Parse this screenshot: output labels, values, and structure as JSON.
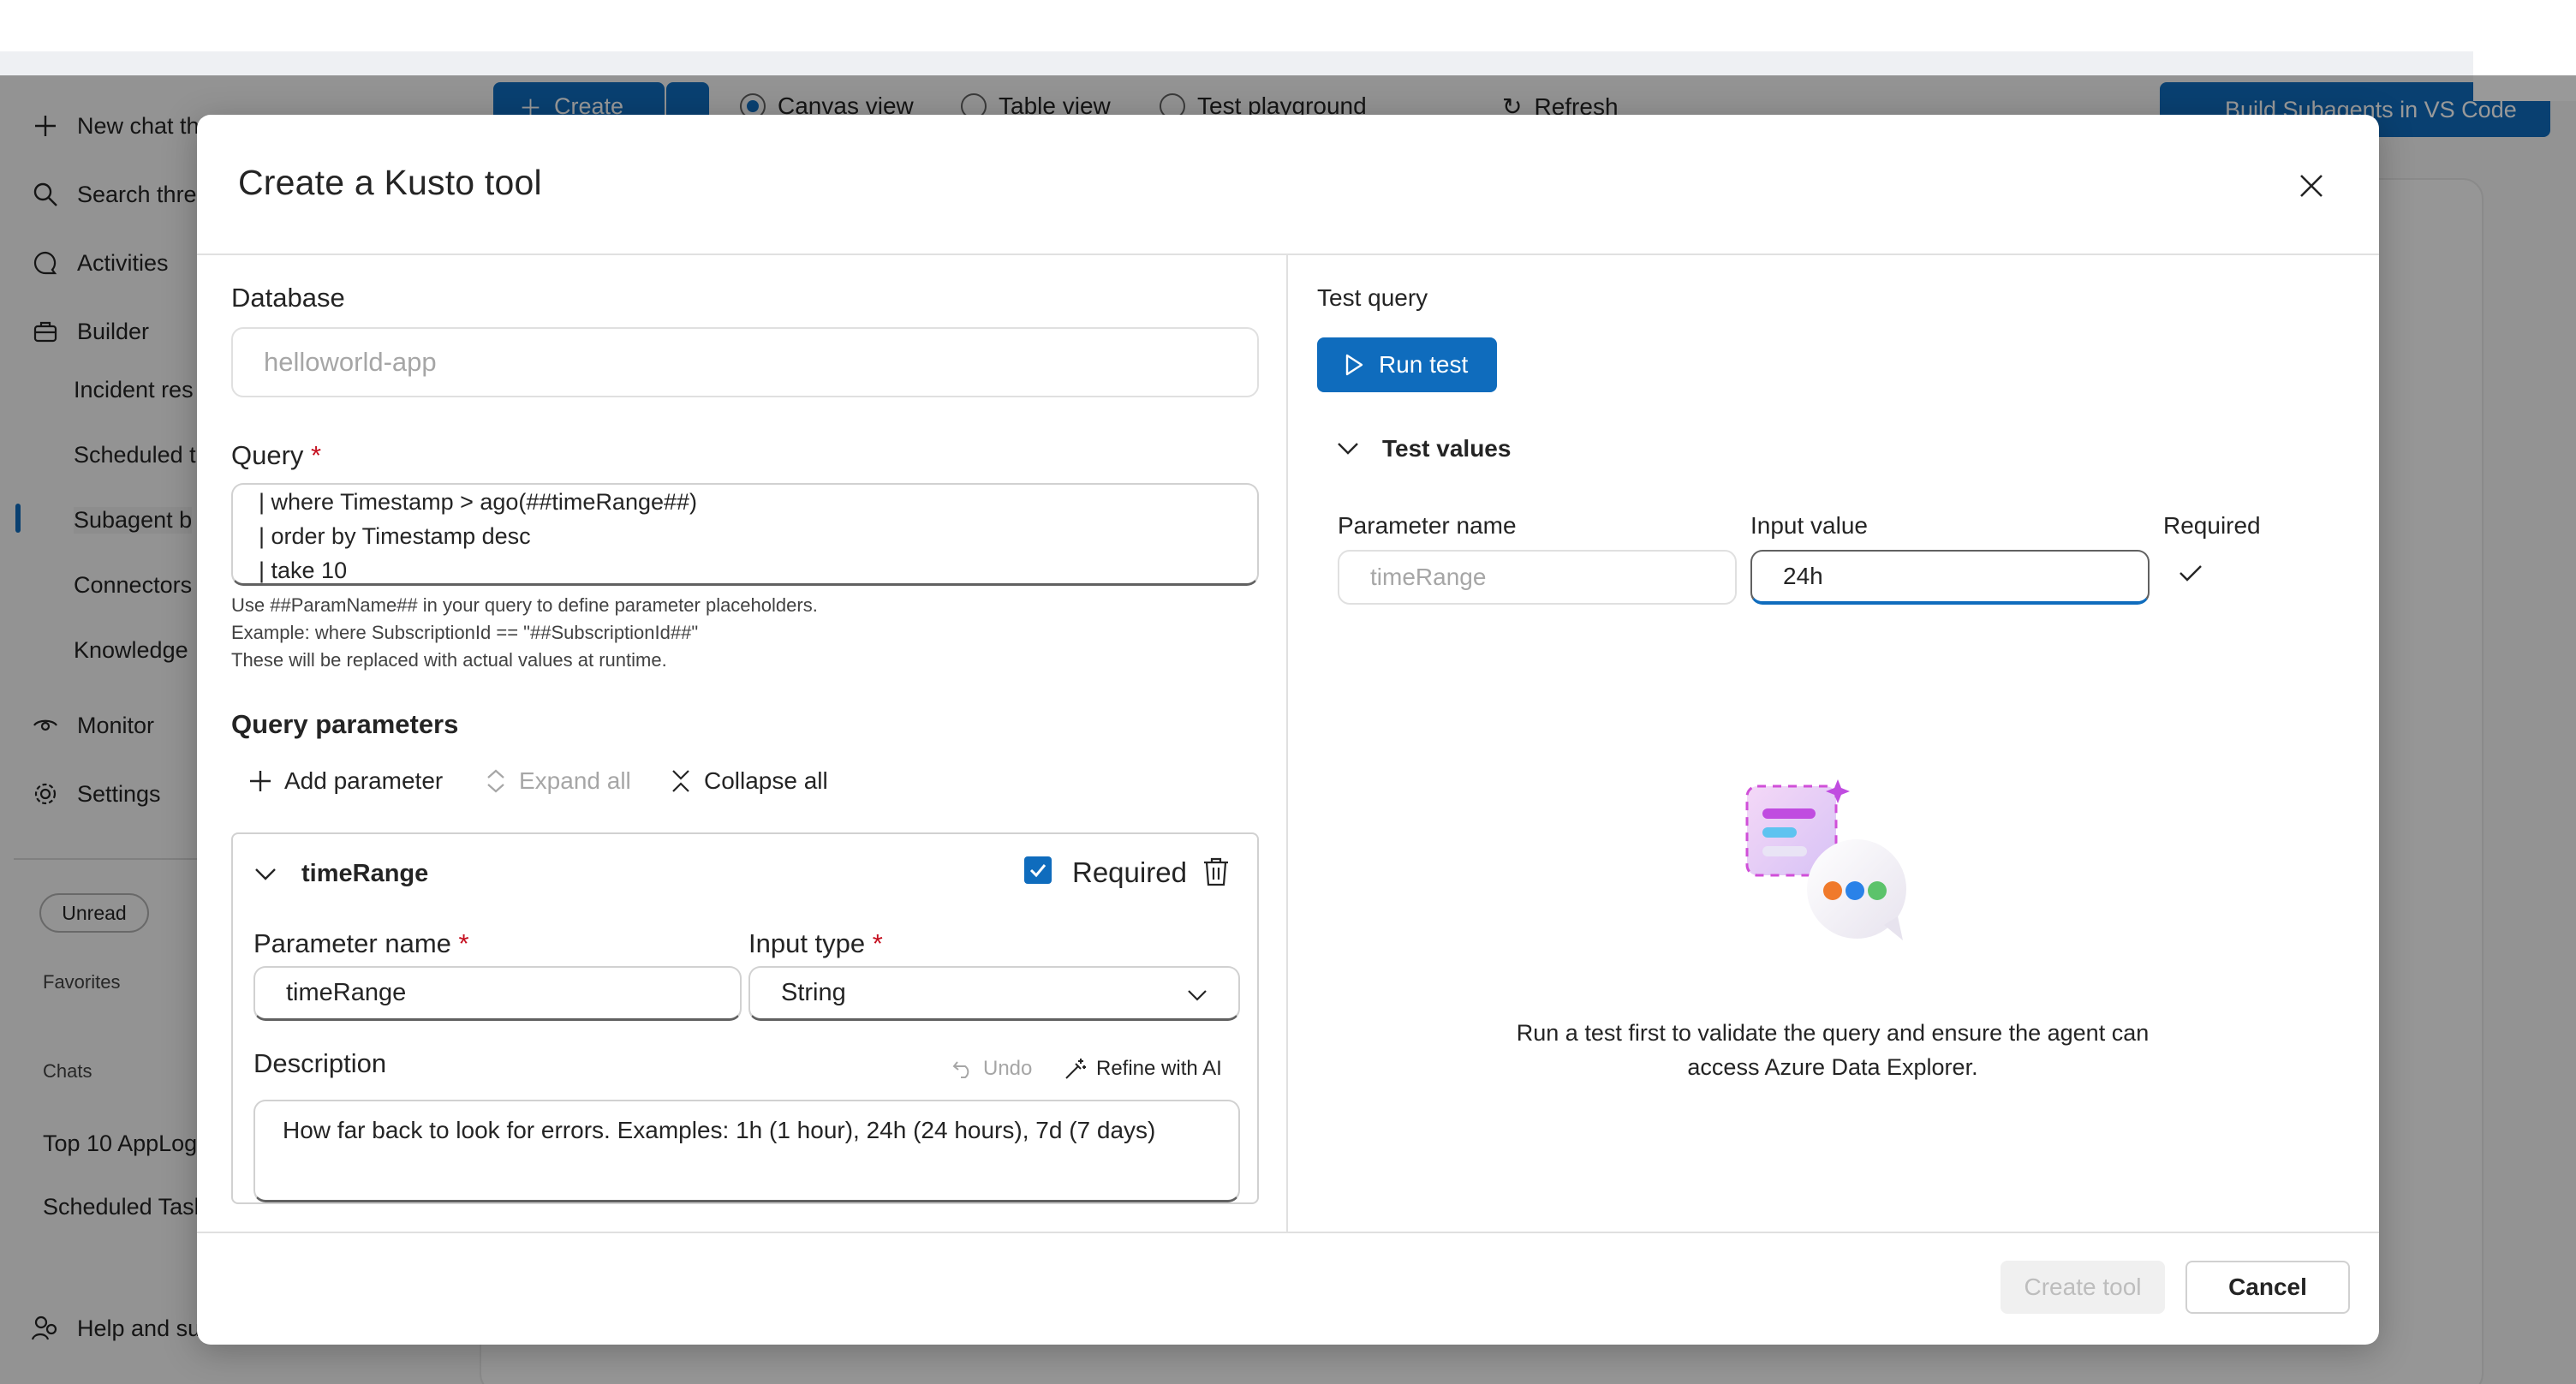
{
  "background_app": {
    "sidebar": {
      "nav": [
        {
          "label": "New chat th",
          "icon": "plus-icon"
        },
        {
          "label": "Search thre",
          "icon": "search-icon"
        },
        {
          "label": "Activities",
          "icon": "chat-bubble-icon"
        },
        {
          "label": "Builder",
          "icon": "briefcase-icon"
        }
      ],
      "builder_items": [
        "Incident res",
        "Scheduled t",
        "Subagent b",
        "Connectors",
        "Knowledge"
      ],
      "monitor": "Monitor",
      "settings": "Settings",
      "unread_chip": "Unread",
      "favorites_heading": "Favorites",
      "chats_heading": "Chats",
      "chat_items": [
        "Top 10 AppLog",
        "Scheduled Tasl"
      ],
      "help": "Help and su"
    },
    "toolbar": {
      "create_label": "Create",
      "views": [
        {
          "label": "Canvas view",
          "selected": true
        },
        {
          "label": "Table view",
          "selected": false
        },
        {
          "label": "Test playground",
          "selected": false
        }
      ],
      "refresh_label": "Refresh",
      "vscode_label": "Build Subagents in VS Code"
    }
  },
  "dialog": {
    "title": "Create a Kusto tool",
    "left": {
      "database_label": "Database",
      "database_placeholder": "helloworld-app",
      "query_label": "Query",
      "query_lines": [
        "| where Timestamp > ago(##timeRange##)",
        "| order by Timestamp desc",
        "| take 10"
      ],
      "hints": [
        "Use ##ParamName## in your query to define parameter placeholders.",
        "Example: where SubscriptionId == \"##SubscriptionId##\"",
        "These will be replaced with actual values at runtime."
      ],
      "params_heading": "Query parameters",
      "add_param": "Add parameter",
      "expand_all": "Expand all",
      "collapse_all": "Collapse all",
      "param": {
        "name": "timeRange",
        "required_label": "Required",
        "required": true,
        "param_name_label": "Parameter name",
        "param_name_value": "timeRange",
        "input_type_label": "Input type",
        "input_type_value": "String",
        "description_label": "Description",
        "undo_label": "Undo",
        "refine_label": "Refine with AI",
        "description_value": "How far back to look for errors. Examples: 1h (1 hour), 24h (24 hours), 7d (7 days)"
      }
    },
    "right": {
      "test_query_label": "Test query",
      "run_test": "Run test",
      "test_values_label": "Test values",
      "col_param_name": "Parameter name",
      "col_input_value": "Input value",
      "col_required": "Required",
      "row_param_name": "timeRange",
      "row_input_value": "24h",
      "empty_message_1": "Run a test first to validate the query and ensure the agent can",
      "empty_message_2": "access Azure Data Explorer."
    },
    "footer": {
      "create_tool": "Create tool",
      "cancel": "Cancel"
    }
  },
  "colors": {
    "accent": "#0f6cbd",
    "required_star": "#c50f1f",
    "overlay": "rgba(0,0,0,0.40)"
  }
}
